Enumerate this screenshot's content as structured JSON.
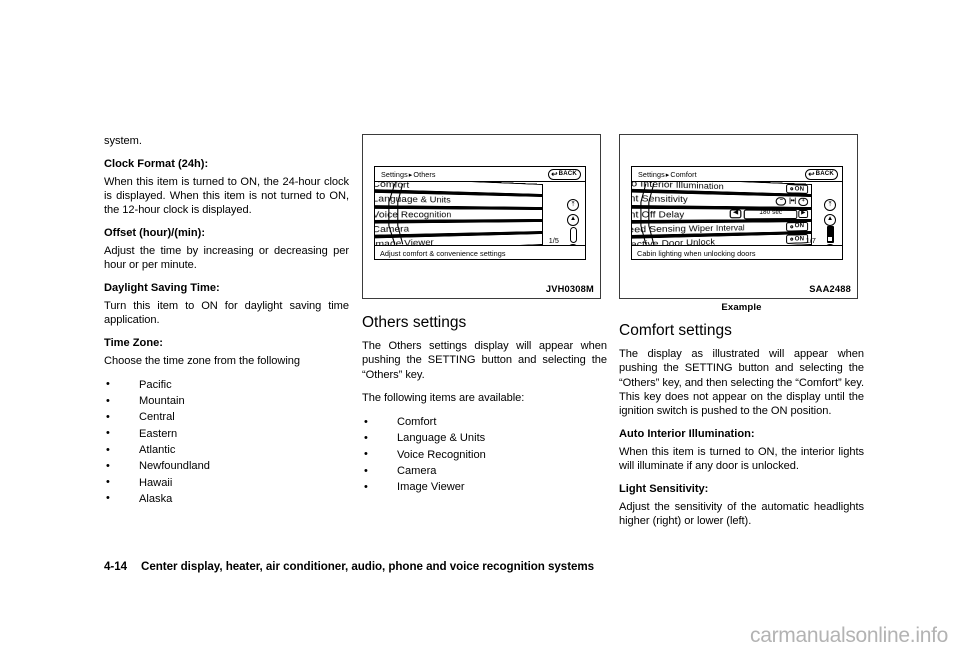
{
  "column1": {
    "continuation": "system.",
    "blocks": [
      {
        "heading": "Clock Format (24h):",
        "body": "When this item is turned to ON, the 24-hour clock is displayed. When this item is not turned to ON, the 12-hour clock is displayed."
      },
      {
        "heading": "Offset (hour)/(min):",
        "body": "Adjust the time by increasing or decreasing per hour or per minute."
      },
      {
        "heading": "Daylight Saving Time:",
        "body": "Turn this item to ON for daylight saving time application."
      },
      {
        "heading": "Time Zone:",
        "body": "Choose the time zone from the following"
      }
    ],
    "time_zones": [
      "Pacific",
      "Mountain",
      "Central",
      "Eastern",
      "Atlantic",
      "Newfoundland",
      "Hawaii",
      "Alaska"
    ]
  },
  "figure1": {
    "code": "JVH0308M",
    "caption": "",
    "screen": {
      "breadcrumb_root": "Settings",
      "breadcrumb_sep": "▸",
      "breadcrumb_current": "Others",
      "back_label": "BACK",
      "back_icon": "back-arrow-icon",
      "rows": [
        {
          "label": "Comfort",
          "control": "none"
        },
        {
          "label": "Language & Units",
          "control": "none"
        },
        {
          "label": "Voice Recognition",
          "control": "none"
        },
        {
          "label": "Camera",
          "control": "none"
        },
        {
          "label": "Image Viewer",
          "control": "none"
        }
      ],
      "page_count": "1/5",
      "status_text": "Adjust comfort & convenience settings",
      "scroll": {
        "top_icon": "double-chevron-up-icon",
        "up_icon": "chevron-up-icon",
        "down_icon": "chevron-down-icon",
        "bottom_icon": "double-chevron-down-icon",
        "track_style": "outline"
      }
    }
  },
  "column2": {
    "section_title": "Others settings",
    "paragraphs": [
      "The Others settings display will appear when pushing the SETTING button and selecting the “Others” key.",
      "The following items are available:"
    ],
    "items": [
      "Comfort",
      "Language & Units",
      "Voice Recognition",
      "Camera",
      "Image Viewer"
    ]
  },
  "figure2": {
    "code": "SAA2488",
    "caption": "Example",
    "screen": {
      "breadcrumb_root": "Settings",
      "breadcrumb_sep": "▸",
      "breadcrumb_current": "Comfort",
      "back_label": "BACK",
      "back_icon": "back-arrow-icon",
      "rows": [
        {
          "label": "Auto Interior Illumination",
          "control": "toggle",
          "value": "ON"
        },
        {
          "label": "Light Sensitivity",
          "control": "slider",
          "minus": "−",
          "plus": "+",
          "scale": "|••|"
        },
        {
          "label": "Light Off Delay",
          "control": "stepper",
          "prev": "◀",
          "next": "▶",
          "value": "180 sec"
        },
        {
          "label": "Speed Sensing Wiper Interval",
          "control": "toggle",
          "value": "ON"
        },
        {
          "label": "Selective Door Unlock",
          "control": "toggle",
          "value": "ON"
        }
      ],
      "page_count": "1/7",
      "status_text": "Cabin lighting when unlocking doors",
      "scroll": {
        "top_icon": "double-chevron-up-icon",
        "up_icon": "chevron-up-icon",
        "down_icon": "chevron-down-icon",
        "bottom_icon": "double-chevron-down-icon",
        "track_style": "filled"
      }
    }
  },
  "column3": {
    "section_title": "Comfort settings",
    "intro": "The display as illustrated will appear when pushing the SETTING button and selecting the “Others” key, and then selecting the “Comfort” key. This key does not appear on the display until the ignition switch is pushed to the ON position.",
    "blocks": [
      {
        "heading": "Auto Interior Illumination:",
        "body": "When this item is turned to ON, the interior lights will illuminate if any door is unlocked."
      },
      {
        "heading": "Light Sensitivity:",
        "body": "Adjust the sensitivity of the automatic headlights higher (right) or lower (left)."
      }
    ]
  },
  "footer": {
    "page_number": "4-14",
    "title": "Center display, heater, air conditioner, audio, phone and voice recognition systems"
  },
  "watermark": "carmanualsonline.info",
  "colors": {
    "ink": "#000000",
    "frame": "#3b3b3b",
    "watermark": "#b3b3b3",
    "paper": "#ffffff"
  }
}
